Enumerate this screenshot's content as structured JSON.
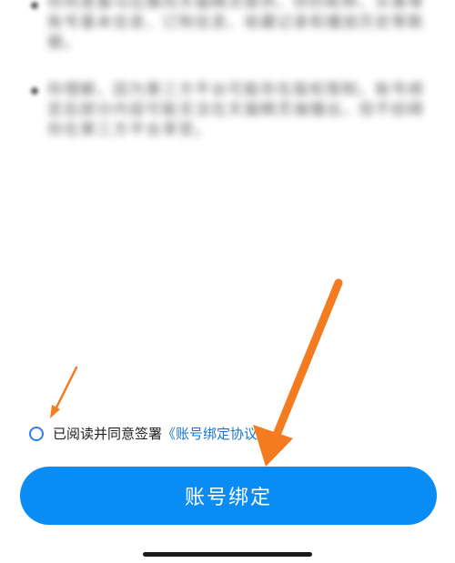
{
  "content": {
    "paragraph1": "你同意基马拉雅向天猫精灵提供、你的昵称、头像等账号基本信息、订购信息、收藏记录和播放历史等数据。",
    "paragraph2": "你理解，因为第三方平台可能存在版权限制，账号绑定后部分内容可能无法在天猫精灵端播出，但不妨碍你在第三方平台享受。"
  },
  "agreement": {
    "prefix": "已阅读并同意签署",
    "link": "《账号绑定协议》",
    "checked": false
  },
  "button": {
    "label": "账号绑定"
  },
  "colors": {
    "primary": "#0a8cf5",
    "link": "#1a76d2",
    "annotation_arrow": "#f47b20"
  }
}
